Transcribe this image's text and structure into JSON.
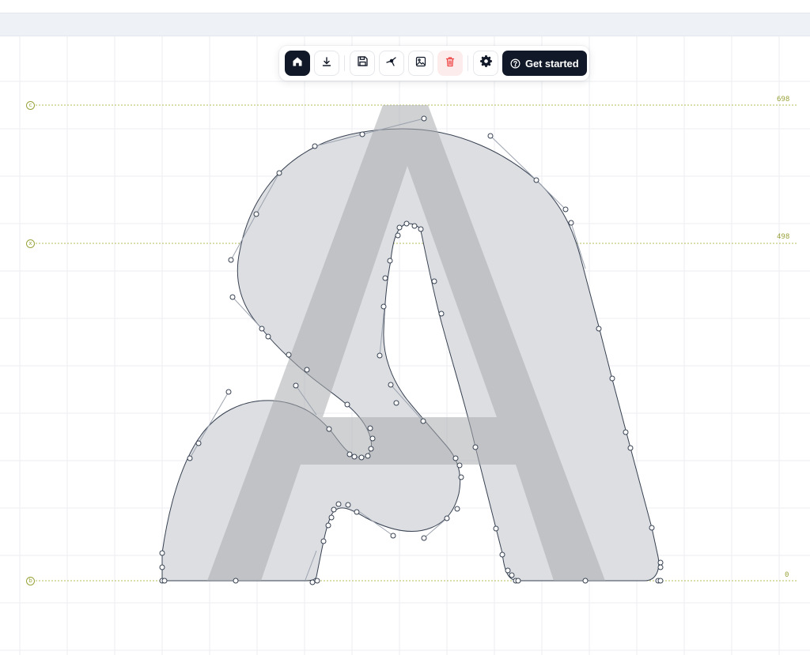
{
  "toolbar": {
    "items": [
      {
        "name": "home",
        "icon": "home-icon",
        "active": true
      },
      {
        "name": "download",
        "icon": "download-icon"
      },
      {
        "name": "save",
        "icon": "save-icon"
      },
      {
        "name": "nodes",
        "icon": "node-tool-icon"
      },
      {
        "name": "image",
        "icon": "image-icon"
      },
      {
        "name": "delete",
        "icon": "trash-icon",
        "danger": true
      },
      {
        "name": "settings",
        "icon": "gear-icon"
      }
    ],
    "cta_label": "Get started",
    "cta_icon": "help-circle-icon"
  },
  "guides": [
    {
      "marker": "c",
      "value": "698"
    },
    {
      "marker": "x",
      "value": "498"
    },
    {
      "marker": "b",
      "value": "0"
    }
  ],
  "colors": {
    "accent": "#111827",
    "danger": "#ef4444",
    "guide": "#9aa33b",
    "glyph_fill": "#dcdee2",
    "reference_glyph": "#a9abae",
    "grid": "#eceef1"
  }
}
